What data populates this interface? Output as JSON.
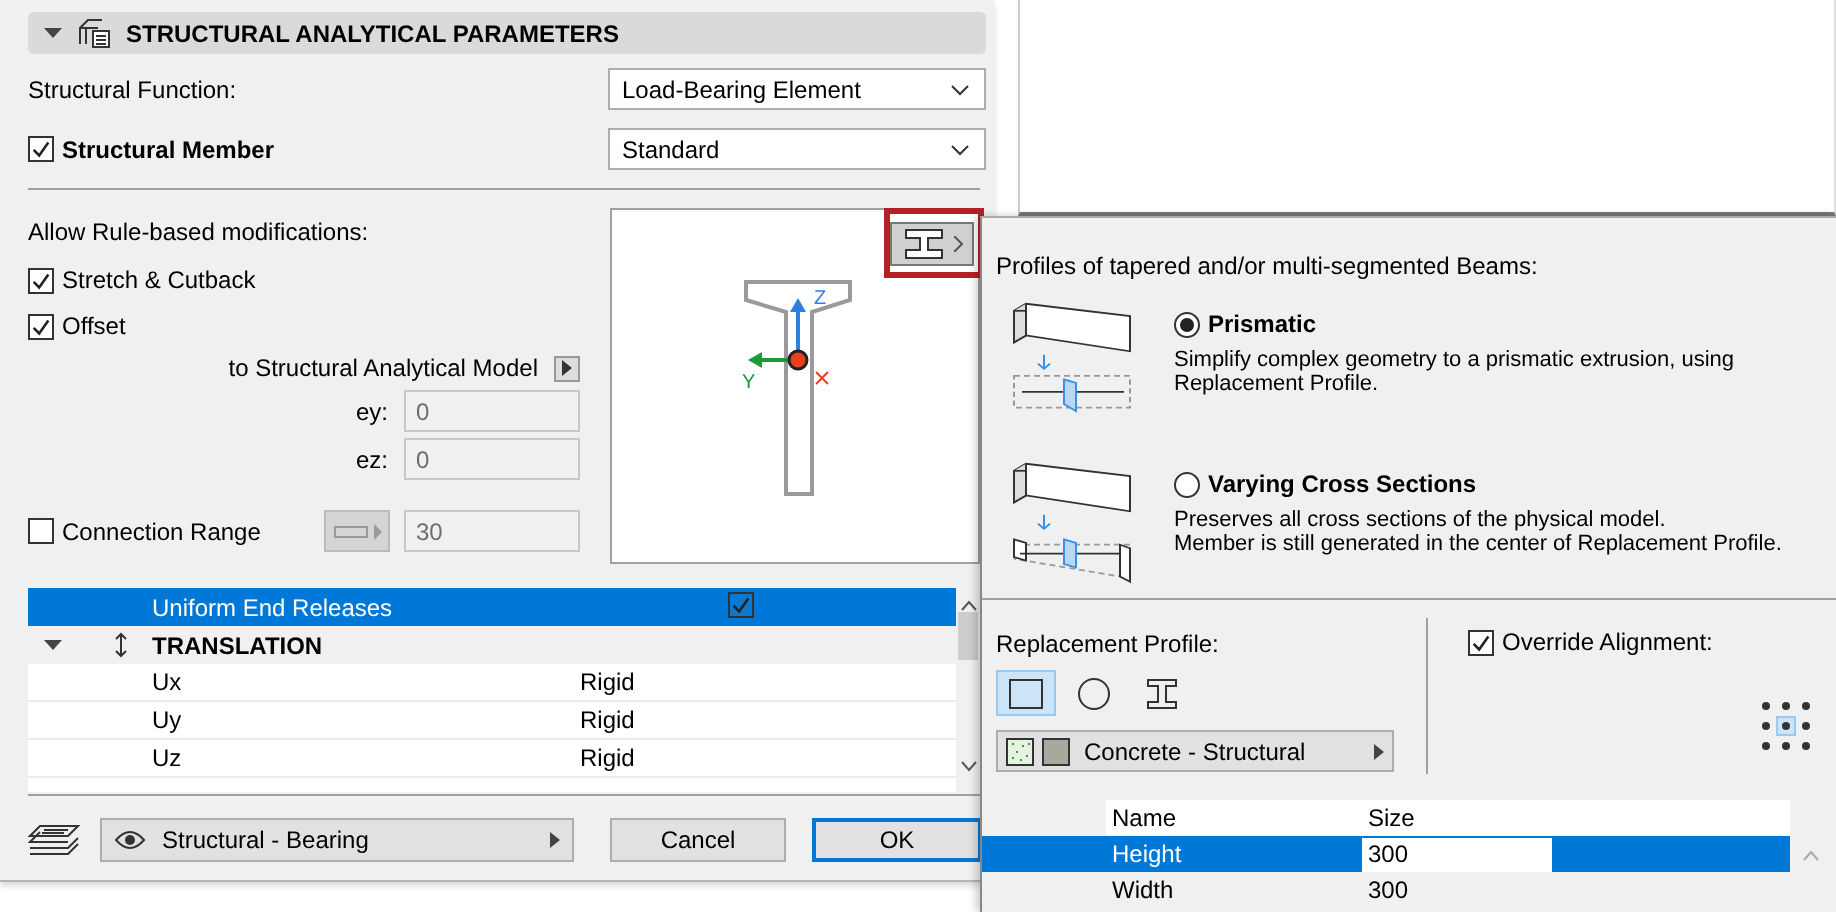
{
  "section": {
    "title": "STRUCTURAL ANALYTICAL PARAMETERS",
    "expanded": true
  },
  "structural_function": {
    "label": "Structural Function:",
    "value": "Load-Bearing Element"
  },
  "structural_member": {
    "label": "Structural Member",
    "checked": true,
    "value": "Standard"
  },
  "rule_based": {
    "label": "Allow Rule-based modifications:",
    "options": [
      {
        "label": "Stretch & Cutback",
        "checked": true
      },
      {
        "label": "Offset",
        "checked": true
      }
    ]
  },
  "offset_target": "to Structural Analytical Model",
  "offsets": [
    {
      "label": "ey:",
      "value": "0",
      "disabled": true
    },
    {
      "label": "ez:",
      "value": "0",
      "disabled": true
    }
  ],
  "connection_range": {
    "label": "Connection Range",
    "checked": false,
    "value": "30",
    "disabled": true
  },
  "preview": {
    "axis_labels": [
      "Z",
      "Y"
    ],
    "profile_button_highlighted": true
  },
  "releases": {
    "header": {
      "label": "Uniform End Releases",
      "checked": true,
      "selected": true
    },
    "group": {
      "label": "TRANSLATION",
      "expanded": true
    },
    "rows": [
      {
        "name": "Ux",
        "value": "Rigid"
      },
      {
        "name": "Uy",
        "value": "Rigid"
      },
      {
        "name": "Uz",
        "value": "Rigid"
      }
    ]
  },
  "layer": {
    "value": "Structural - Bearing"
  },
  "buttons": [
    {
      "label": "Cancel",
      "default": false
    },
    {
      "label": "OK",
      "default": true
    }
  ],
  "popup": {
    "title": "Profiles of tapered and/or multi-segmented Beams:",
    "options": [
      {
        "kind": "prismatic",
        "label": "Prismatic",
        "selected": true,
        "description": "Simplify complex geometry to a prismatic extrusion, using Replacement Profile."
      },
      {
        "kind": "varying",
        "label": "Varying Cross Sections",
        "selected": false,
        "description": "Preserves all cross sections of the physical model.\nMember is still generated in the center of Replacement Profile."
      }
    ],
    "replacement_profile": {
      "label": "Replacement Profile:",
      "shapes": [
        {
          "kind": "rectangle",
          "selected": true
        },
        {
          "kind": "circle",
          "selected": false
        },
        {
          "kind": "ibeam",
          "selected": false
        }
      ],
      "material": "Concrete - Structural"
    },
    "override_alignment": {
      "label": "Override Alignment:",
      "checked": true
    },
    "anchor_points": [
      {
        "selected": false
      },
      {
        "selected": false
      },
      {
        "selected": false
      },
      {
        "selected": false
      },
      {
        "selected": true
      },
      {
        "selected": false
      },
      {
        "selected": false
      },
      {
        "selected": false
      },
      {
        "selected": false
      }
    ],
    "table": {
      "columns": [
        "Name",
        "Size"
      ],
      "rows": [
        {
          "name": "Height",
          "value": "300",
          "selected": true
        },
        {
          "name": "Width",
          "value": "300",
          "selected": false
        }
      ]
    }
  }
}
